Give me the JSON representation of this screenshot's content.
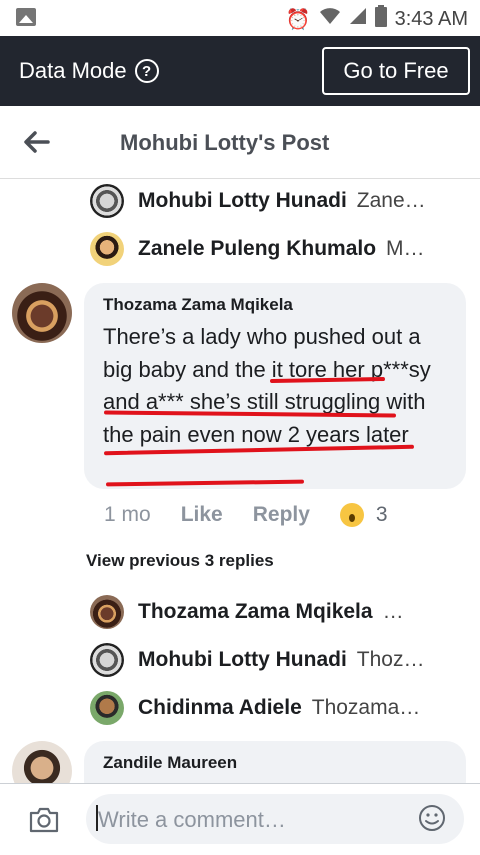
{
  "status_bar": {
    "time": "3:43 AM"
  },
  "data_mode": {
    "label": "Data Mode",
    "help_glyph": "?",
    "go_free_label": "Go to Free"
  },
  "header": {
    "title": "Mohubi Lotty's Post"
  },
  "top_replies": [
    {
      "name": "Mohubi Lotty Hunadi",
      "snippet": "Zane…"
    },
    {
      "name": "Zanele Puleng Khumalo",
      "snippet": "M…"
    }
  ],
  "comment": {
    "author": "Thozama Zama Mqikela",
    "text": "There’s a lady who pushed out a big baby and the it tore her p***sy and a*** she’s still struggling with the pain even now 2 years later",
    "time": "1 mo",
    "like_label": "Like",
    "reply_label": "Reply",
    "reaction_count": "3"
  },
  "view_previous": "View previous 3 replies",
  "replies": [
    {
      "name": "Thozama Zama Mqikela",
      "snippet": "…"
    },
    {
      "name": "Mohubi Lotty Hunadi",
      "snippet": "Thoz…"
    },
    {
      "name": "Chidinma Adiele",
      "snippet": "Thozama…"
    }
  ],
  "next_comment": {
    "author": "Zandile Maureen"
  },
  "composer": {
    "placeholder": "Write a comment…"
  },
  "colors": {
    "dark_bar": "#22262f",
    "underline": "#e0121b",
    "bubble": "#f0f2f5"
  }
}
